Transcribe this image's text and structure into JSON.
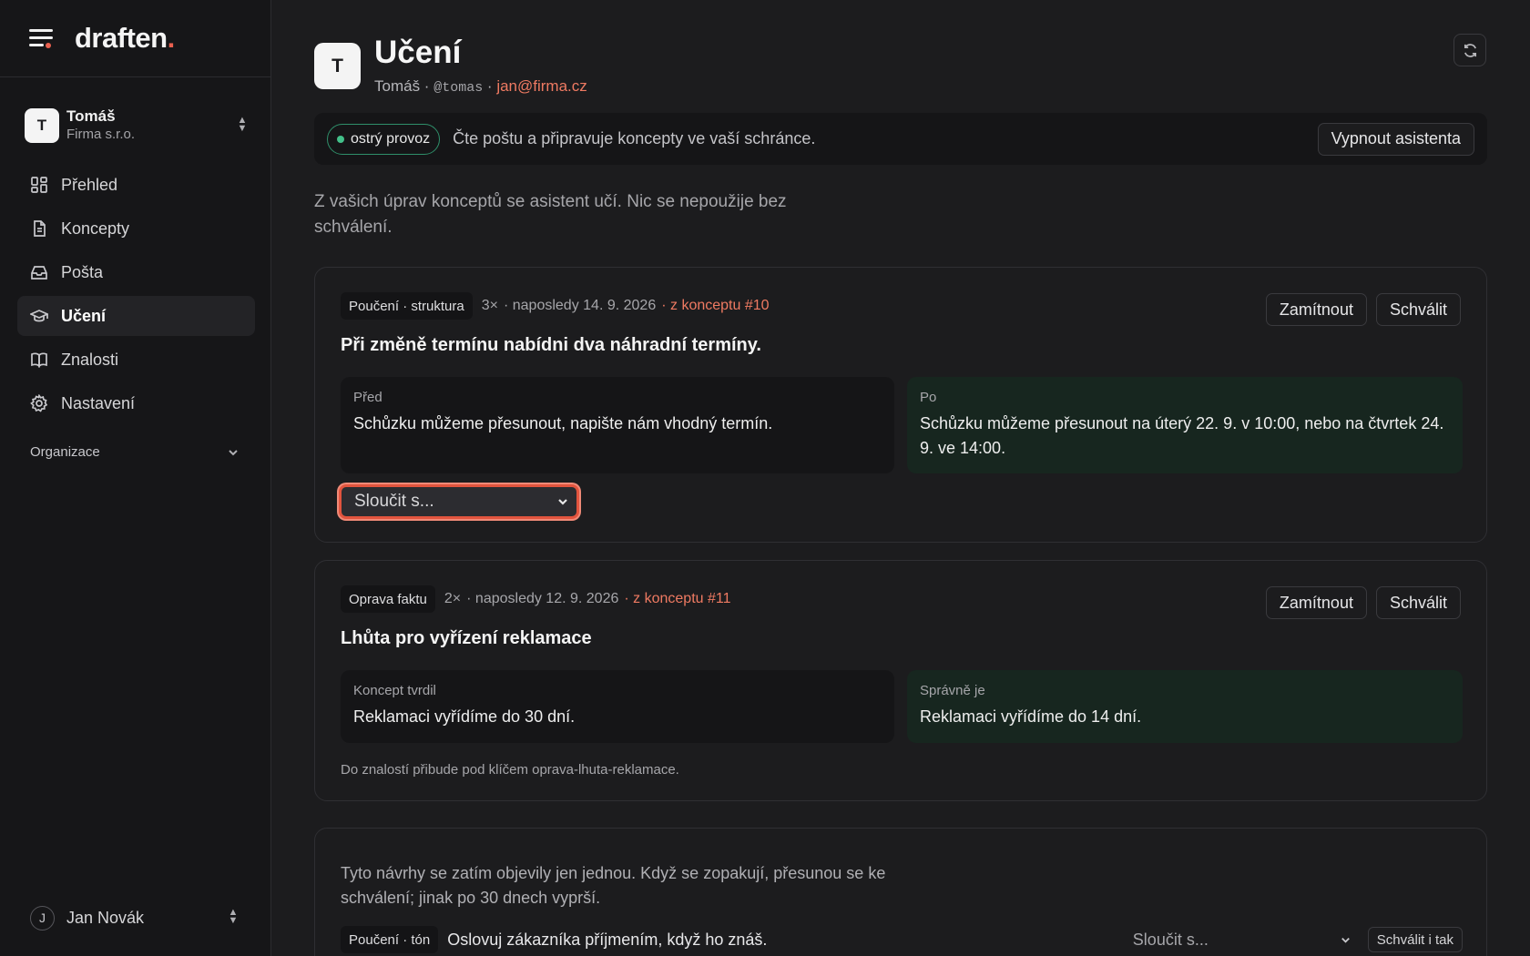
{
  "brand": {
    "name": "draften",
    "dot": "."
  },
  "account": {
    "initial": "T",
    "name": "Tomáš",
    "org": "Firma s.r.o."
  },
  "nav": {
    "items": [
      {
        "label": "Přehled",
        "icon": "dashboard-icon"
      },
      {
        "label": "Koncepty",
        "icon": "document-icon"
      },
      {
        "label": "Pošta",
        "icon": "inbox-icon"
      },
      {
        "label": "Učení",
        "icon": "graduation-cap-icon",
        "active": true
      },
      {
        "label": "Znalosti",
        "icon": "book-icon"
      },
      {
        "label": "Nastavení",
        "icon": "gear-icon"
      }
    ],
    "org_section": "Organizace"
  },
  "user": {
    "initial": "J",
    "name": "Jan Novák"
  },
  "header": {
    "initial": "T",
    "title": "Učení",
    "name": "Tomáš",
    "sep1": " · ",
    "handle": "@tomas",
    "sep2": " · ",
    "email": "jan@firma.cz"
  },
  "status": {
    "pill": "ostrý provoz",
    "text": "Čte poštu a připravuje koncepty ve vaší schránce.",
    "button": "Vypnout asistenta"
  },
  "intro": "Z vašich úprav konceptů se asistent učí. Nic se nepoužije bez schválení.",
  "cards": [
    {
      "tag": "Poučení · struktura",
      "count": "3×",
      "last": "· naposledy 14. 9. 2026",
      "source": "· z konceptu #10",
      "rule": "Při změně termínu nabídni dva náhradní termíny.",
      "before_label": "Před",
      "before_text": "Schůzku můžeme přesunout, napište nám vhodný termín.",
      "after_label": "Po",
      "after_text": "Schůzku můžeme přesunout na úterý 22. 9. v 10:00, nebo na čtvrtek 24. 9. ve 14:00.",
      "merge_placeholder": "Sloučit s...",
      "reject": "Zamítnout",
      "approve": "Schválit"
    },
    {
      "tag": "Oprava faktu",
      "count": "2×",
      "last": "· naposledy 12. 9. 2026",
      "source": "· z konceptu #11",
      "rule": "Lhůta pro vyřízení reklamace",
      "before_label": "Koncept tvrdil",
      "before_text": "Reklamaci vyřídíme do 30 dní.",
      "after_label": "Správně je",
      "after_text": "Reklamaci vyřídíme do 14 dní.",
      "note": "Do znalostí přibude pod klíčem oprava-lhuta-reklamace.",
      "reject": "Zamítnout",
      "approve": "Schválit"
    }
  ],
  "pending": {
    "text": "Tyto návrhy se zatím objevily jen jednou. Když se zopakují, přesunou se ke schválení; jinak po 30 dnech vyprší.",
    "item": {
      "tag": "Poučení · tón",
      "text": "Oslovuj zákazníka příjmením, když ho znáš.",
      "merge_placeholder": "Sloučit s...",
      "approve_anyway": "Schválit i tak"
    }
  },
  "colors": {
    "accent": "#ef7a62",
    "live": "#43c08a",
    "after_bg": "#17261f",
    "focus": "#e2543e"
  }
}
